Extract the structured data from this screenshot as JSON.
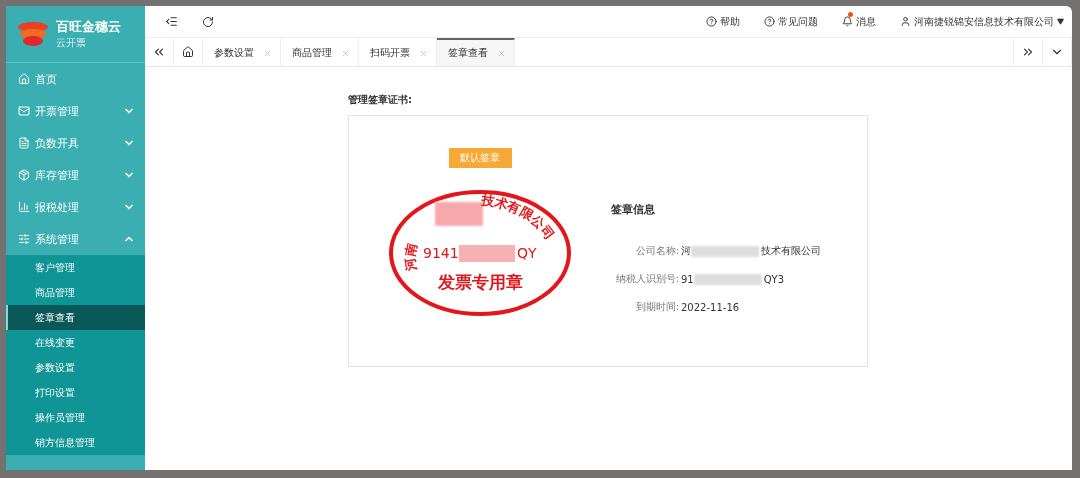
{
  "brand": {
    "name": "百旺金穗云",
    "subtitle": "云开票"
  },
  "header": {
    "links": [
      {
        "kind": "help",
        "label": "帮助"
      },
      {
        "kind": "help",
        "label": "常见问题"
      },
      {
        "kind": "bell",
        "label": "消息",
        "badge": true
      }
    ],
    "user": "河南捷锐锦安信息技术有限公司"
  },
  "tabs": [
    {
      "label": "参数设置",
      "selected": false
    },
    {
      "label": "商品管理",
      "selected": false
    },
    {
      "label": "扫码开票",
      "selected": false
    },
    {
      "label": "签章查看",
      "selected": true
    }
  ],
  "sidebar": {
    "items": [
      {
        "label": "首页"
      },
      {
        "label": "开票管理",
        "expanded": false
      },
      {
        "label": "负数开具",
        "expanded": false
      },
      {
        "label": "库存管理",
        "expanded": false
      },
      {
        "label": "报税处理",
        "expanded": false
      },
      {
        "label": "系统管理",
        "expanded": true,
        "children": [
          {
            "label": "客户管理",
            "selected": false
          },
          {
            "label": "商品管理",
            "selected": false
          },
          {
            "label": "签章查看",
            "selected": true
          },
          {
            "label": "在线变更",
            "selected": false
          },
          {
            "label": "参数设置",
            "selected": false
          },
          {
            "label": "打印设置",
            "selected": false
          },
          {
            "label": "操作员管理",
            "selected": false
          },
          {
            "label": "销方信息管理",
            "selected": false
          }
        ]
      }
    ]
  },
  "content": {
    "title": "管理签章证书:",
    "default_button": "默认签章",
    "seal": {
      "arc_start": "河南",
      "arc_end": "技术有限公司",
      "code_start": "9141",
      "code_end": "QY",
      "title": "发票专用章"
    },
    "info": {
      "title": "签章信息",
      "fields": [
        {
          "label": "公司名称:",
          "value_start": "河",
          "value_end": "技术有限公司"
        },
        {
          "label": "纳税人识别号:",
          "value_start": "91",
          "value_end": "QY3"
        },
        {
          "label": "到期时间:",
          "value_start": "2022-11-16"
        }
      ]
    }
  }
}
